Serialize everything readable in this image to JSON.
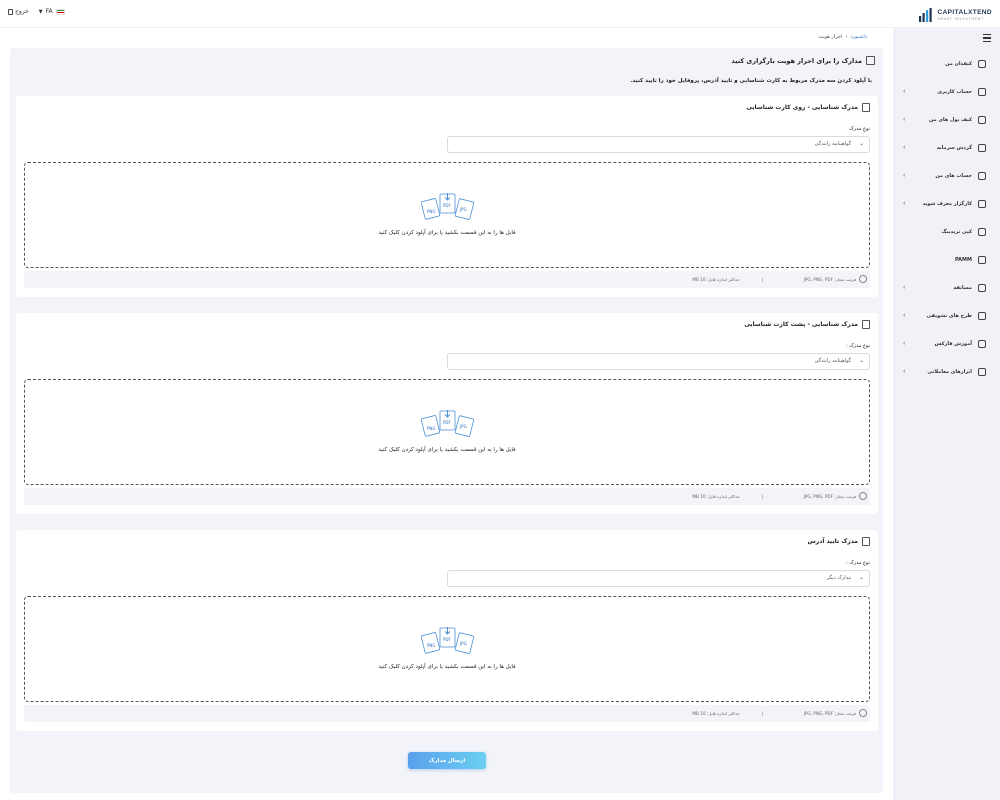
{
  "brand": {
    "name": "CAPITALXTEND",
    "tagline": "SMART INVESTMENT"
  },
  "topbar": {
    "logout": "خروج",
    "lang": "FA"
  },
  "breadcrumb": {
    "home": "داشبورد",
    "current": "احراز هویت"
  },
  "page": {
    "title": "مدارک را برای احراز هویت بارگزاری کنید",
    "description": "با آپلود کردن سه مدرک مربوط به کارت شناسایی و تایید آدرس، پروفایل خود را تایید کنید."
  },
  "sidebar": {
    "items": [
      {
        "label": "کیفدان من",
        "icon": "home-icon",
        "arrow": false
      },
      {
        "label": "حساب کاربری",
        "icon": "user-icon",
        "arrow": true
      },
      {
        "label": "کیف پول های من",
        "icon": "wallet-icon",
        "arrow": true
      },
      {
        "label": "گردش سرمایه",
        "icon": "scale-icon",
        "arrow": true
      },
      {
        "label": "حساب های من",
        "icon": "users-icon",
        "arrow": true
      },
      {
        "label": "کارگزار معرف شوید",
        "icon": "handshake-icon",
        "arrow": true
      },
      {
        "label": "کپی تریدینگ",
        "icon": "copy-icon",
        "arrow": false
      },
      {
        "label": "PAMM",
        "icon": "refresh-icon",
        "arrow": false
      },
      {
        "label": "مسابقه",
        "icon": "trophy-icon",
        "arrow": true
      },
      {
        "label": "طرح های تشویقی",
        "icon": "gift-icon",
        "arrow": true
      },
      {
        "label": "آموزش فارکس",
        "icon": "education-icon",
        "arrow": true
      },
      {
        "label": "ابزارهای معاملاتی",
        "icon": "tools-icon",
        "arrow": true
      }
    ]
  },
  "cards": [
    {
      "title": "مدرک شناسایی - روی کارت شناسایی",
      "type_label": "نوع مدرک",
      "type_value": "گواهینامه رانندگی",
      "icon": "id-card-icon"
    },
    {
      "title": "مدرک شناسایی - پشت کارت شناسایی",
      "type_label": "نوع مدرک :",
      "type_value": "گواهینامه رانندگی",
      "icon": "id-card-back-icon"
    },
    {
      "title": "مدرک تایید آدرس",
      "type_label": "نوع مدرک :",
      "type_value": "مدارک دیگر",
      "icon": "location-icon"
    }
  ],
  "upload": {
    "dropzone_text": "فایل ها را به این قسمت بکشید یا برای آپلود کردن کلیک کنید",
    "formats_label": "فرمت مجاز: JPG, PNG, PDF",
    "separator": "|",
    "max_size_label": "حداکثر اندازه فایل: 10 MB",
    "file_types": [
      "PNG",
      "PDF",
      "JPG"
    ]
  },
  "submit": {
    "label": "ارسال مدارک"
  },
  "colors": {
    "accent": "#3a72c8",
    "button_start": "#5aa0ec",
    "button_end": "#6bcff1",
    "sidebar_bg": "#f0f2f7",
    "content_bg": "#f2f4f9"
  }
}
